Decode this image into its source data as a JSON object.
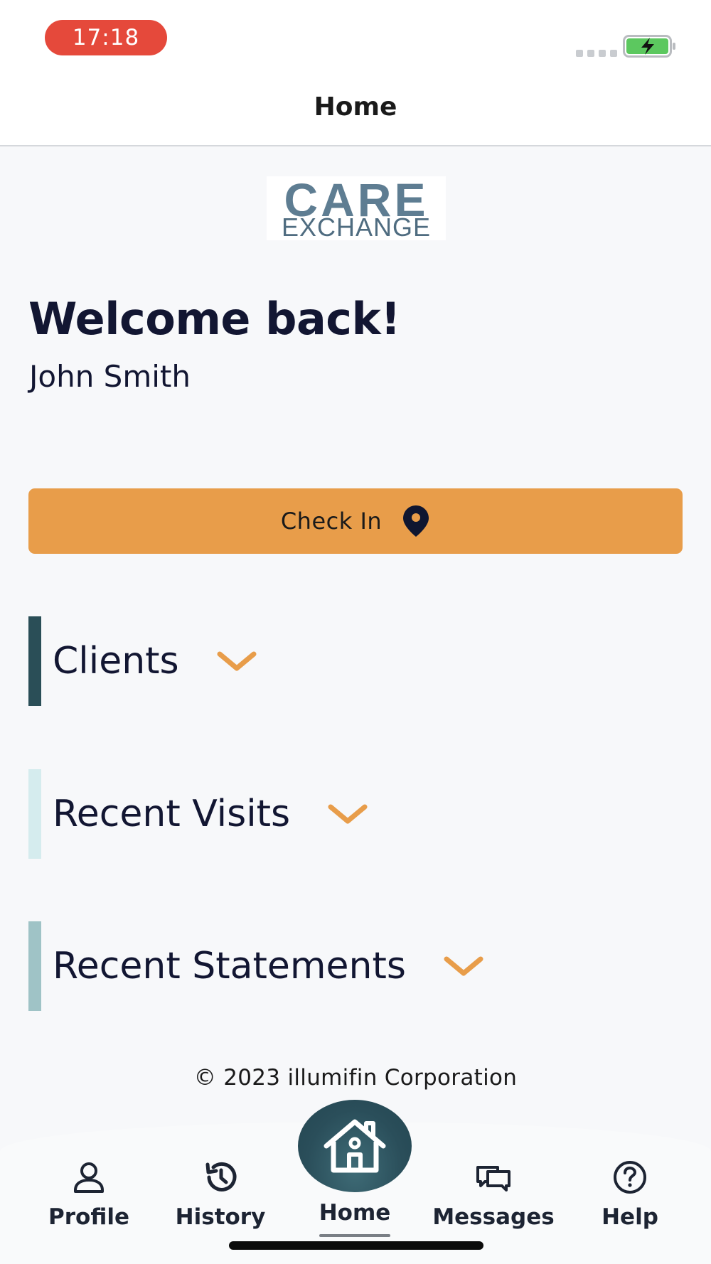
{
  "status_bar": {
    "time": "17:18"
  },
  "header": {
    "title": "Home"
  },
  "logo": {
    "line1": "CARE",
    "line2": "EXCHANGE"
  },
  "greeting": {
    "title": "Welcome back!",
    "user_name": "John Smith"
  },
  "check_in": {
    "label": "Check In",
    "icon": "location-pin-icon"
  },
  "sections": [
    {
      "label": "Clients",
      "accent": "#2a4e57",
      "icon": "chevron-down-icon"
    },
    {
      "label": "Recent Visits",
      "accent": "#d5ecee",
      "icon": "chevron-down-icon"
    },
    {
      "label": "Recent Statements",
      "accent": "#9fc3c6",
      "icon": "chevron-down-icon"
    }
  ],
  "footer": {
    "copyright": "© 2023 illumifin Corporation"
  },
  "bottom_nav": {
    "active": "Home",
    "items": [
      {
        "label": "Profile",
        "icon": "person-icon"
      },
      {
        "label": "History",
        "icon": "history-icon"
      },
      {
        "label": "Home",
        "icon": "house-icon"
      },
      {
        "label": "Messages",
        "icon": "chat-bubbles-icon"
      },
      {
        "label": "Help",
        "icon": "question-circle-icon"
      }
    ]
  },
  "colors": {
    "primary_orange": "#e89d4a",
    "home_bubble": "#2a4e5a",
    "time_pill": "#e5493b",
    "battery_fill": "#5cc85f",
    "text_dark": "#121632"
  }
}
